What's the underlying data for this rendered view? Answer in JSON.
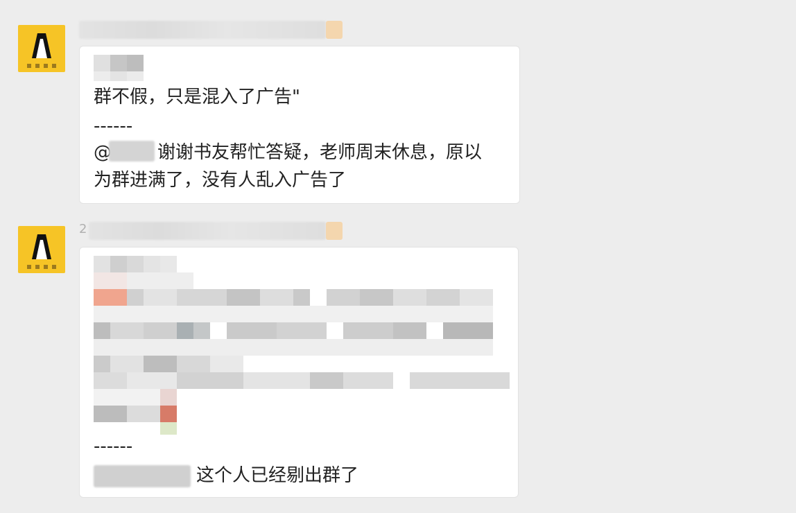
{
  "messages": [
    {
      "sender": "",
      "lines": [
        "群不假，只是混入了广告\"",
        "------",
        "@",
        "谢谢书友帮忙答疑，老师周末休息，原以",
        "为群进满了，没有人乱入广告了"
      ]
    },
    {
      "sender": "2",
      "lines": [
        "------",
        "这个人已经剔出群了"
      ]
    }
  ],
  "colors": {
    "background": "#ededed",
    "bubble": "#ffffff",
    "avatar": "#f6c426"
  },
  "icons": [
    "app-logo-icon"
  ]
}
